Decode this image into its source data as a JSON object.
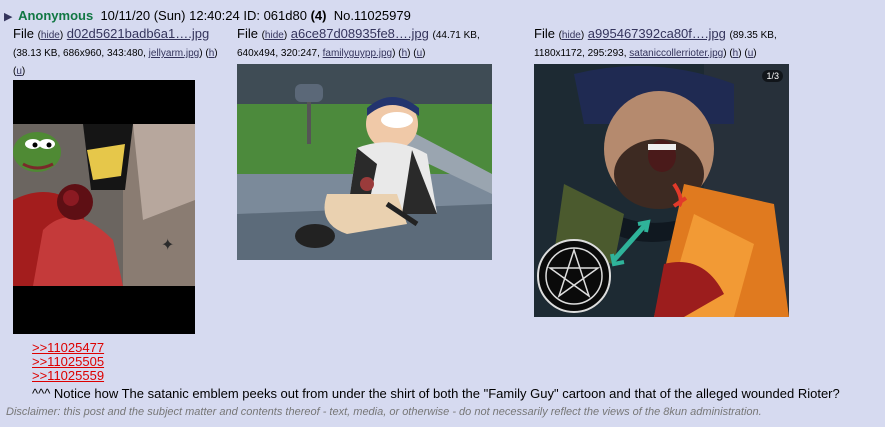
{
  "post": {
    "name": "Anonymous",
    "datetime": "10/11/20 (Sun) 12:40:24",
    "id_label": "ID: 061d80",
    "reply_count": "(4)",
    "number": "No.11025979"
  },
  "files": [
    {
      "label": "File",
      "hide": "hide",
      "filename": "d02d5621badb6a1….jpg",
      "meta_prefix": "(38.13 KB, 686x960, 343:480,",
      "orig_name": "jellyarm.jpg",
      "h": "h",
      "u": "u"
    },
    {
      "label": "File",
      "hide": "hide",
      "filename": "a6ce87d08935fe8….jpg",
      "meta_prefix": "(44.71 KB,",
      "meta_line2": "640x494, 320:247,",
      "orig_name": "familyguypp.jpg",
      "h": "h",
      "u": "u"
    },
    {
      "label": "File",
      "hide": "hide",
      "filename": "a995467392ca80f….jpg",
      "meta_prefix": "(89.35 KB,",
      "meta_line2": "1180x1172, 295:293,",
      "orig_name": "sataniccollerrioter.jpg",
      "h": "h",
      "u": "u",
      "badge": "1/3"
    }
  ],
  "quotes": [
    ">>11025477",
    ">>11025505",
    ">>11025559"
  ],
  "body": "^^^ Notice how The satanic emblem peeks out from under the shirt of both the \"Family Guy\" cartoon and that of the alleged wounded Rioter?",
  "disclaimer": "Disclaimer: this post and the subject matter and contents thereof - text, media, or otherwise - do not necessarily reflect the views of the 8kun administration."
}
